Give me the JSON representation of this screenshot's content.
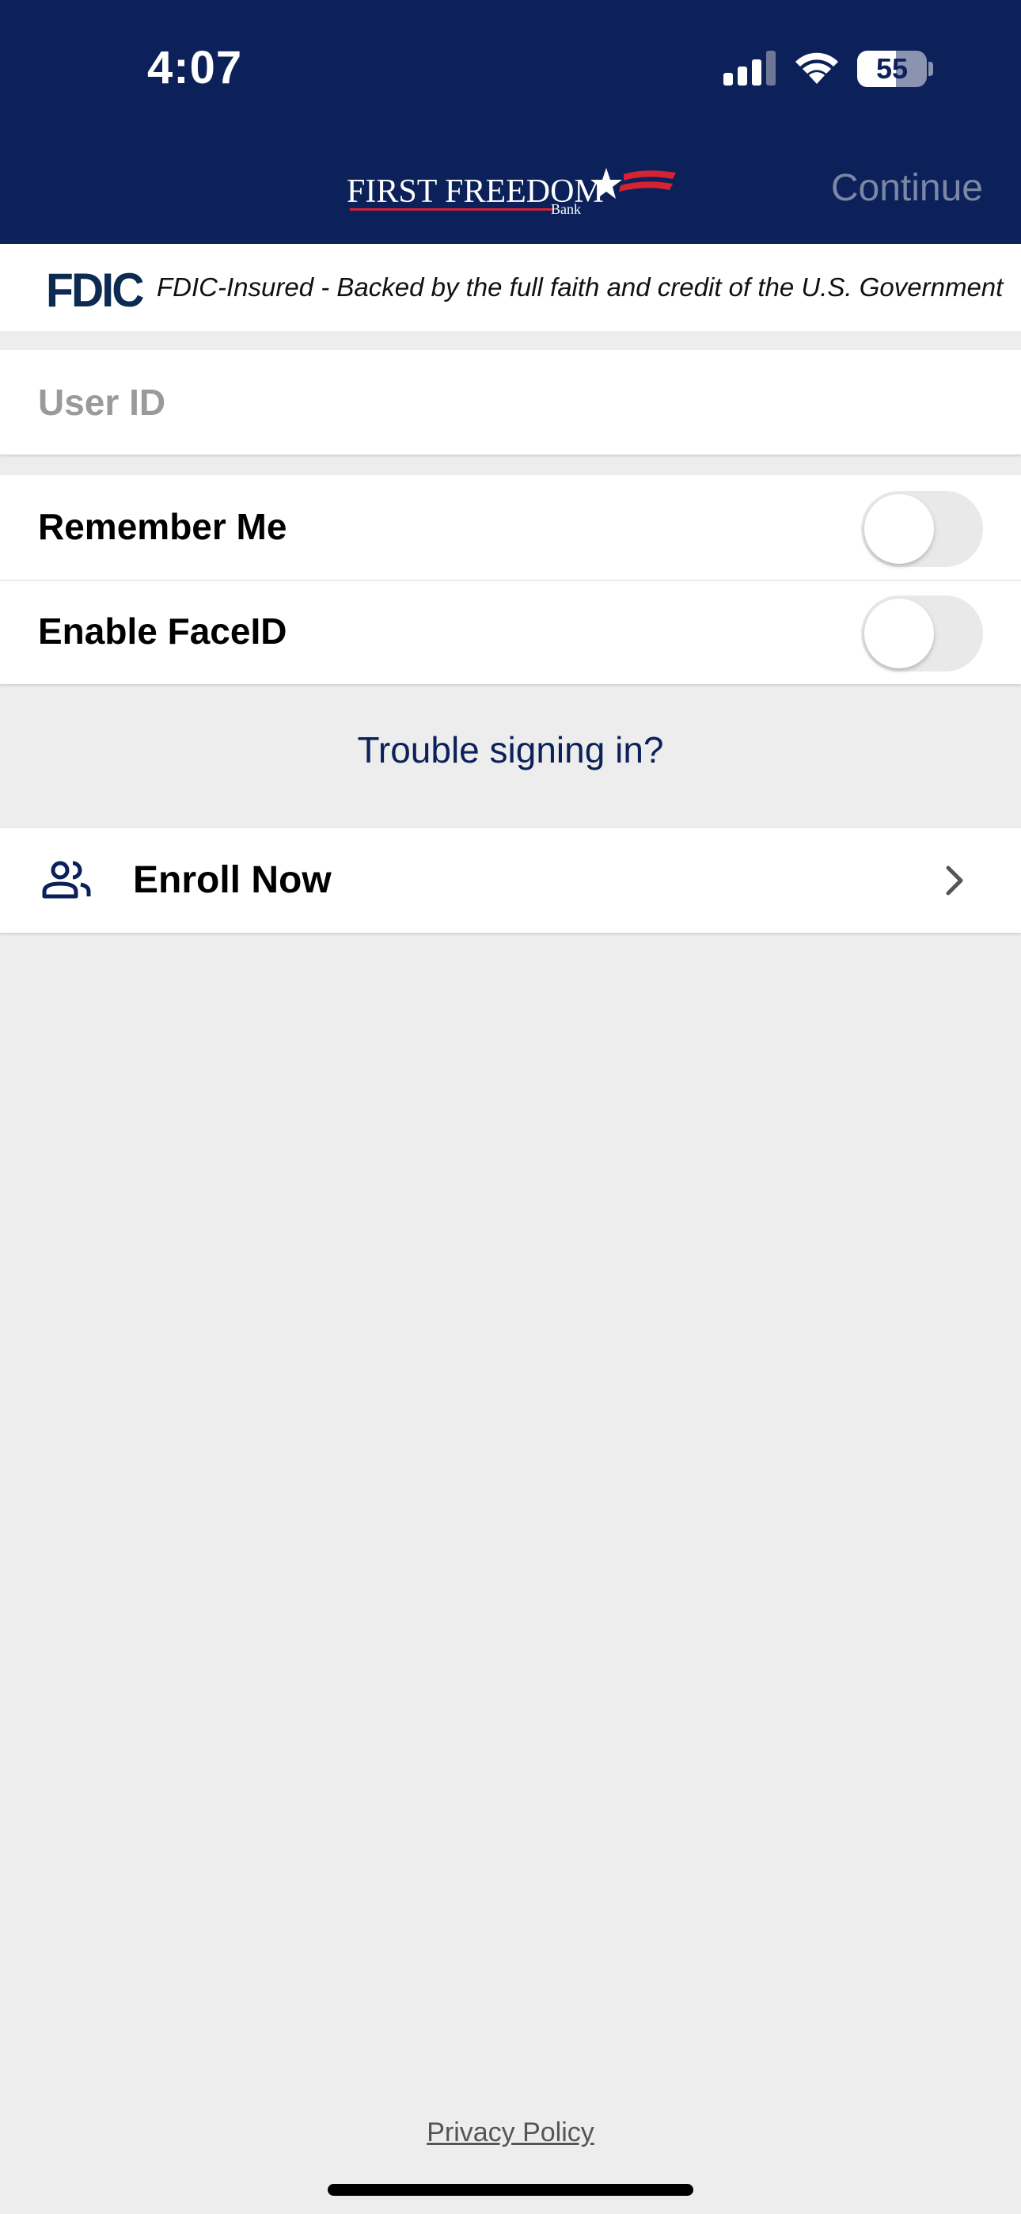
{
  "status_bar": {
    "time": "4:07",
    "battery": "55",
    "icons": [
      "cellular-signal-icon",
      "wifi-icon",
      "battery-icon"
    ]
  },
  "header": {
    "logo": {
      "name": "FIRST FREEDOM",
      "subtitle": "Bank"
    },
    "continue_label": "Continue",
    "background_color": "#0c2159",
    "continue_color": "#7c87a6"
  },
  "fdic": {
    "logo_text": "FDIC",
    "notice": "FDIC-Insured - Backed by the full faith and credit of the U.S. Government"
  },
  "login": {
    "user_id_placeholder": "User ID",
    "user_id_value": ""
  },
  "settings": {
    "remember_me": {
      "label": "Remember Me",
      "enabled": false
    },
    "face_id": {
      "label": "Enable FaceID",
      "enabled": false
    }
  },
  "trouble_link": "Trouble signing in?",
  "enroll": {
    "label": "Enroll Now",
    "icon": "people-icon"
  },
  "footer": {
    "privacy_policy": "Privacy Policy"
  }
}
